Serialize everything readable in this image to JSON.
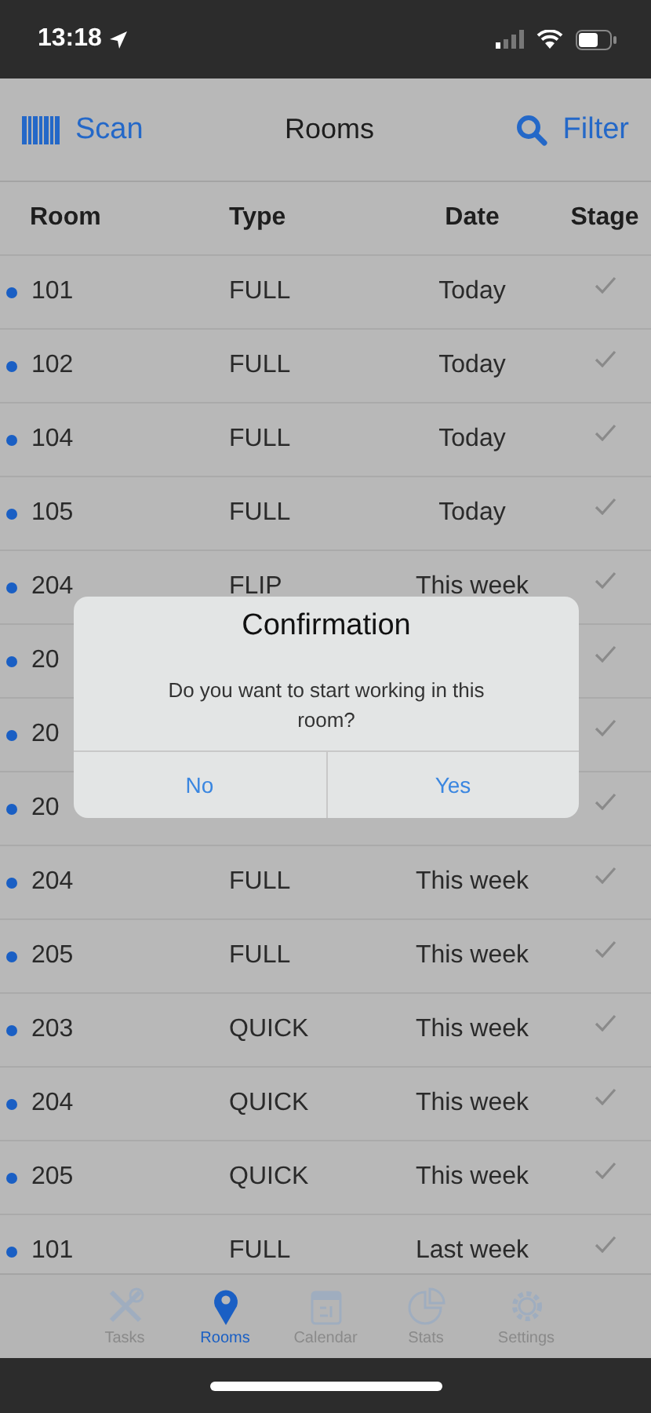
{
  "status_bar": {
    "time": "13:18"
  },
  "nav": {
    "left": "Scan",
    "title": "Rooms",
    "right": "Filter"
  },
  "table": {
    "columns": [
      "Room",
      "Type",
      "Date",
      "Stage"
    ],
    "rows": [
      {
        "room": "101",
        "type": "FULL",
        "date": "Today",
        "checked": true
      },
      {
        "room": "102",
        "type": "FULL",
        "date": "Today",
        "checked": true
      },
      {
        "room": "104",
        "type": "FULL",
        "date": "Today",
        "checked": true
      },
      {
        "room": "105",
        "type": "FULL",
        "date": "Today",
        "checked": true
      },
      {
        "room": "204",
        "type": "FLIP",
        "date": "This week",
        "checked": true
      },
      {
        "room": "20",
        "checked": true
      },
      {
        "room": "20",
        "checked": true
      },
      {
        "room": "20",
        "checked": true
      },
      {
        "room": "204",
        "type": "FULL",
        "date": "This week",
        "checked": true
      },
      {
        "room": "205",
        "type": "FULL",
        "date": "This week",
        "checked": true
      },
      {
        "room": "203",
        "type": "QUICK",
        "date": "This week",
        "checked": true
      },
      {
        "room": "204",
        "type": "QUICK",
        "date": "This week",
        "checked": true
      },
      {
        "room": "205",
        "type": "QUICK",
        "date": "This week",
        "checked": true
      },
      {
        "room": "101",
        "type": "FULL",
        "date": "Last week",
        "checked": true
      }
    ]
  },
  "dialog": {
    "title": "Confirmation",
    "message": "Do you want to start working in this room?",
    "buttons": [
      "No",
      "Yes"
    ]
  },
  "tab_bar": [
    {
      "label": "Tasks",
      "kind": "tools",
      "selected": false
    },
    {
      "label": "Rooms",
      "kind": "pin",
      "selected": true
    },
    {
      "label": "Calendar",
      "kind": "calendar",
      "selected": false
    },
    {
      "label": "Stats",
      "kind": "pie",
      "selected": false
    },
    {
      "label": "Settings",
      "kind": "gear",
      "selected": false
    }
  ]
}
